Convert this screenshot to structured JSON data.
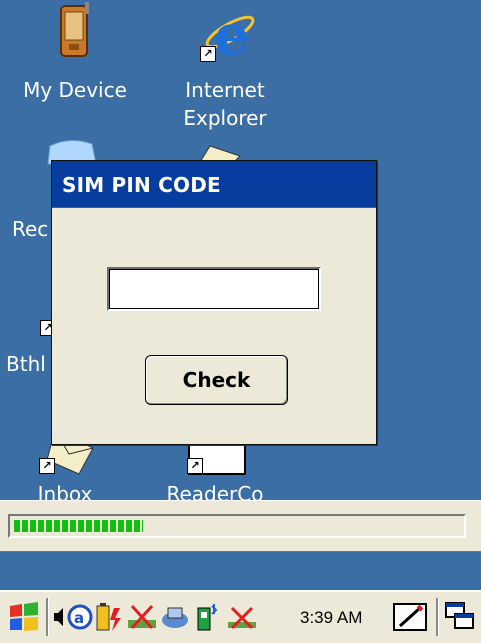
{
  "desktop": {
    "icons": [
      {
        "label": "My Device"
      },
      {
        "label_line1": "Internet",
        "label_line2": "Explorer"
      },
      {
        "label": "Rec"
      },
      {
        "label": "Bthl"
      },
      {
        "label": "Inbox"
      },
      {
        "label": "ReaderCo"
      }
    ]
  },
  "dialog": {
    "title": "SIM PIN CODE",
    "pin_value": "",
    "check_label": "Check"
  },
  "progress": {
    "fraction": 0.29,
    "color": "#10c010"
  },
  "taskbar": {
    "start_icon": "windows-flag-icon",
    "clock": "3:39 AM",
    "tray_icons": [
      "speaker-icon",
      "input-method-icon",
      "battery-icon",
      "network-disconnected-icon",
      "connection-icon",
      "bluetooth-icon",
      "radio-disconnected-icon"
    ],
    "accent": "#083c9e"
  }
}
